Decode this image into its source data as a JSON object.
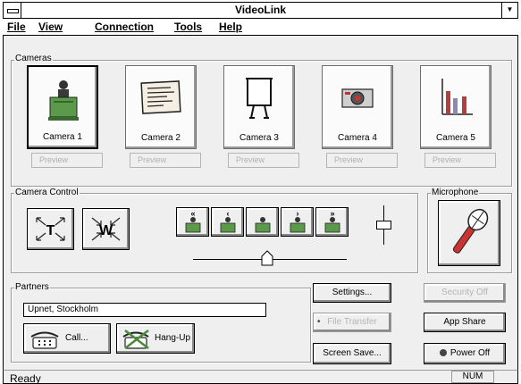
{
  "window": {
    "title": "VideoLink"
  },
  "menu": [
    {
      "label": "File"
    },
    {
      "label": "View"
    },
    {
      "label": "Connection"
    },
    {
      "label": "Tools"
    },
    {
      "label": "Help"
    }
  ],
  "cameras": {
    "label": "Cameras",
    "items": [
      {
        "label": "Camera 1",
        "preview": "Preview",
        "icon": "presenter-at-podium-icon",
        "selected": true
      },
      {
        "label": "Camera 2",
        "preview": "Preview",
        "icon": "document-icon",
        "selected": false
      },
      {
        "label": "Camera 3",
        "preview": "Preview",
        "icon": "flip-chart-icon",
        "selected": false
      },
      {
        "label": "Camera 4",
        "preview": "Preview",
        "icon": "video-camera-icon",
        "selected": false
      },
      {
        "label": "Camera 5",
        "preview": "Preview",
        "icon": "bar-chart-icon",
        "selected": false
      }
    ]
  },
  "camera_control": {
    "label": "Camera Control",
    "tele": "T",
    "wide": "W",
    "pan_buttons": [
      {
        "arrows": "«"
      },
      {
        "arrows": "‹"
      },
      {
        "arrows": ""
      },
      {
        "arrows": "›"
      },
      {
        "arrows": "»"
      }
    ]
  },
  "microphone": {
    "label": "Microphone"
  },
  "partners": {
    "label": "Partners",
    "value": "Upnet, Stockholm",
    "call_label": "Call...",
    "hangup_label": "Hang-Up"
  },
  "buttons": {
    "settings": "Settings...",
    "file_transfer": "File Transfer",
    "screen_save": "Screen Save...",
    "security": "Security Off",
    "app_share": "App Share",
    "power_off": "Power Off"
  },
  "status": {
    "text": "Ready",
    "num": "NUM"
  },
  "colors": {
    "accent_green": "#4a8a3a",
    "power_led": "#444444"
  }
}
